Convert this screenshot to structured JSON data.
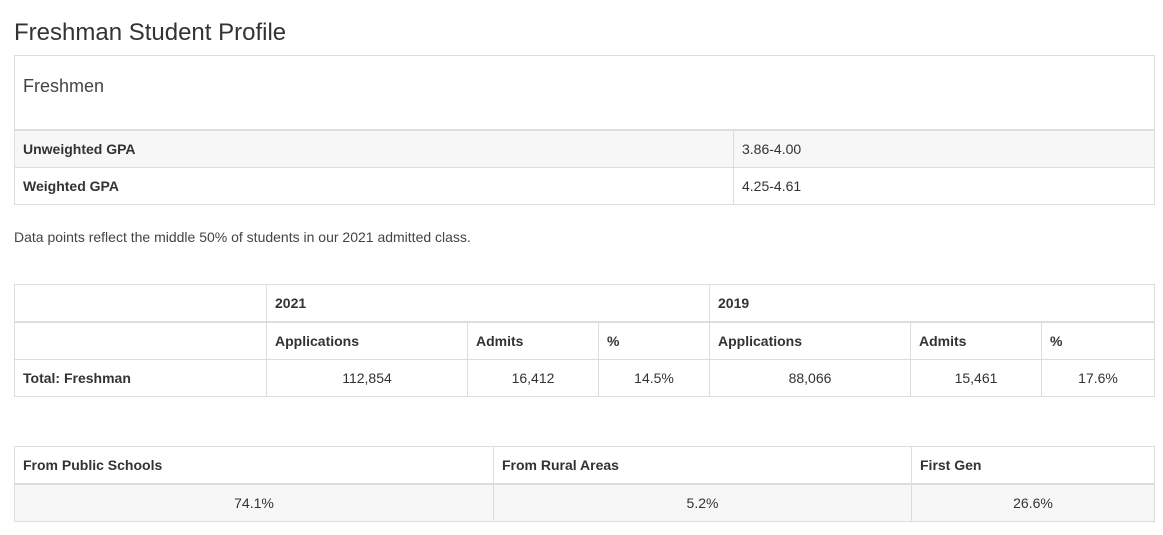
{
  "page_title": "Freshman Student Profile",
  "gpa": {
    "caption": "Freshmen",
    "rows": [
      {
        "label": "Unweighted GPA",
        "value": "3.86-4.00"
      },
      {
        "label": "Weighted GPA",
        "value": "4.25-4.61"
      }
    ]
  },
  "note": "Data points reflect the middle 50% of students in our 2021 admitted class.",
  "applications": {
    "years": [
      "2021",
      "2019"
    ],
    "headers": [
      "Applications",
      "Admits",
      "%",
      "Applications",
      "Admits",
      "%"
    ],
    "row_label": "Total: Freshman",
    "values": [
      "112,854",
      "16,412",
      "14.5%",
      "88,066",
      "15,461",
      "17.6%"
    ]
  },
  "demographics": {
    "headers": [
      "From Public Schools",
      "From Rural Areas",
      "First Gen"
    ],
    "values": [
      "74.1%",
      "5.2%",
      "26.6%"
    ]
  }
}
